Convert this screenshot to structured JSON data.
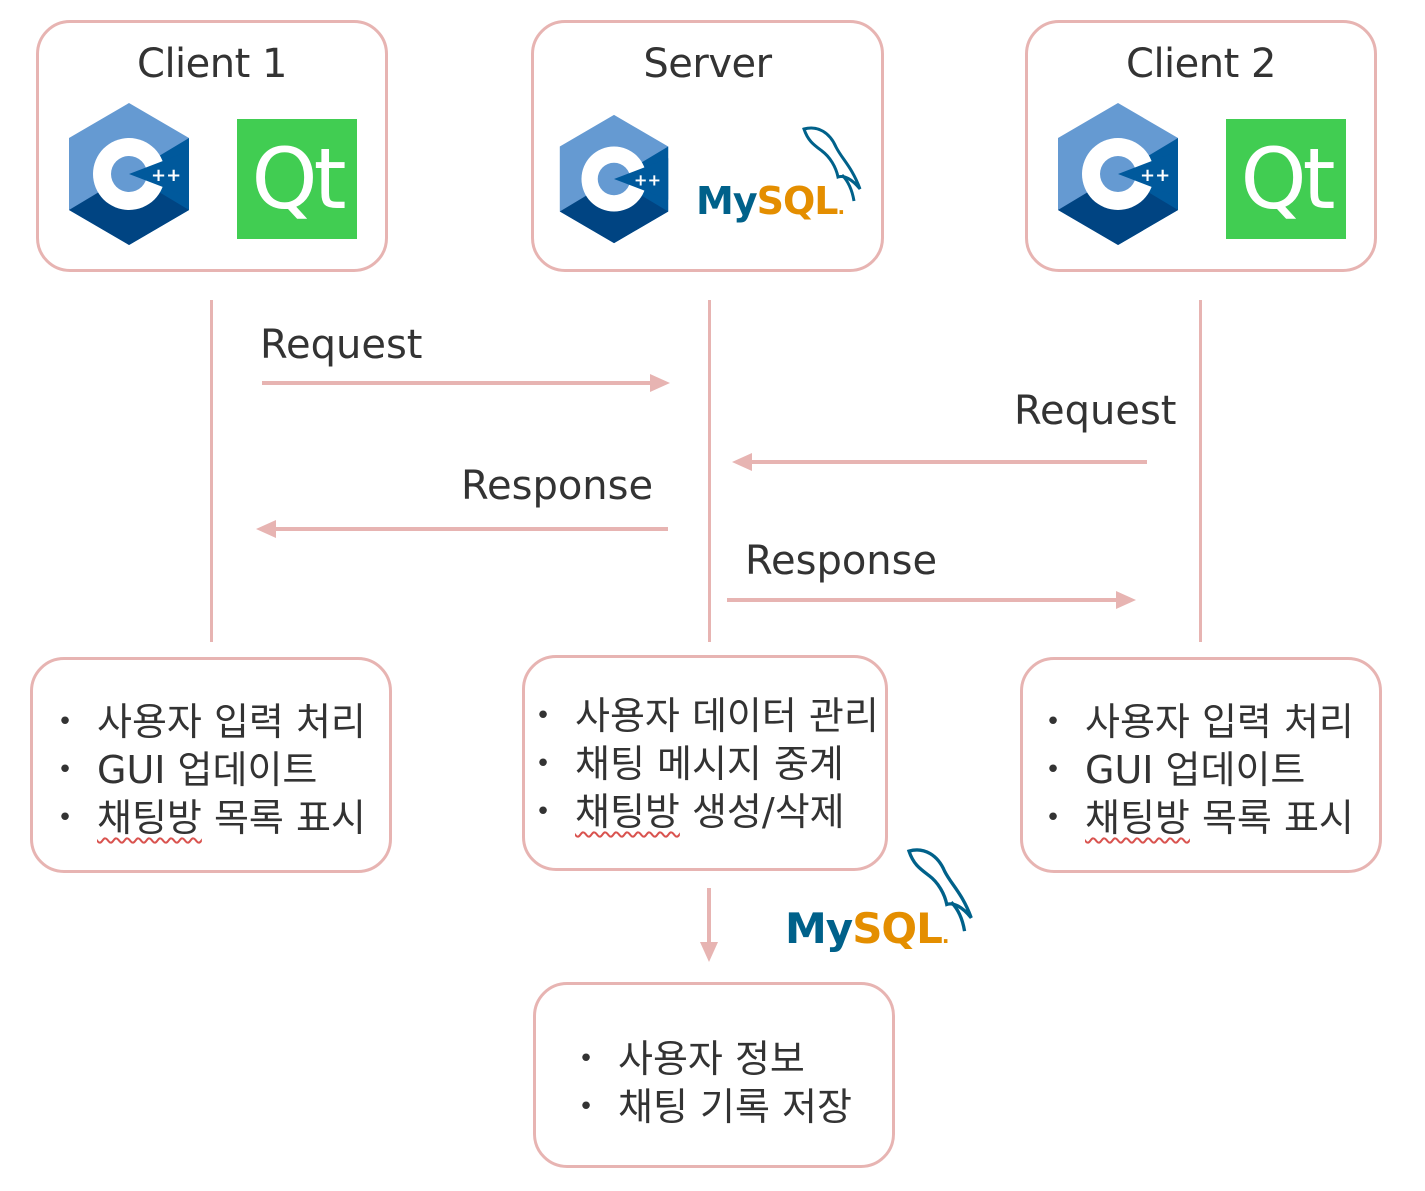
{
  "nodes": {
    "client1": {
      "title": "Client 1",
      "logos": [
        "cpp-logo",
        "qt-logo"
      ],
      "qt_text": "Qt",
      "duties": [
        {
          "text_a": "사용자 입력 처리",
          "text_b": ""
        },
        {
          "text_a": "GUI 업데이트",
          "text_b": ""
        },
        {
          "text_a": "채팅방",
          "text_b": " 목록 표시"
        }
      ]
    },
    "server": {
      "title": "Server",
      "logos": [
        "cpp-logo",
        "mysql-logo"
      ],
      "mysql_my": "My",
      "mysql_sql": "SQL",
      "duties": [
        {
          "text_a": "사용자 데이터 관리",
          "text_b": ""
        },
        {
          "text_a": "채팅 메시지 중계",
          "text_b": ""
        },
        {
          "text_a": "채팅방",
          "text_b": " 생성/삭제"
        }
      ]
    },
    "client2": {
      "title": "Client 2",
      "logos": [
        "cpp-logo",
        "qt-logo"
      ],
      "qt_text": "Qt",
      "duties": [
        {
          "text_a": "사용자 입력 처리",
          "text_b": ""
        },
        {
          "text_a": "GUI 업데이트",
          "text_b": ""
        },
        {
          "text_a": "채팅방",
          "text_b": " 목록 표시"
        }
      ]
    },
    "database": {
      "logo": "mysql-logo",
      "mysql_my": "My",
      "mysql_sql": "SQL",
      "stores": [
        "사용자 정보",
        "채팅 기록 저장"
      ]
    }
  },
  "messages": [
    {
      "label": "Request",
      "from": "client1",
      "to": "server"
    },
    {
      "label": "Request",
      "from": "client2",
      "to": "server"
    },
    {
      "label": "Response",
      "from": "server",
      "to": "client1"
    },
    {
      "label": "Response",
      "from": "server",
      "to": "client2"
    }
  ],
  "colors": {
    "border": "#e7b4b2",
    "text": "#333333",
    "qt_green": "#41cd52",
    "cpp_light": "#659ad2",
    "cpp_dark": "#00599c",
    "cpp_mid": "#004482",
    "mysql_blue": "#00618a",
    "mysql_orange": "#e48e00"
  }
}
